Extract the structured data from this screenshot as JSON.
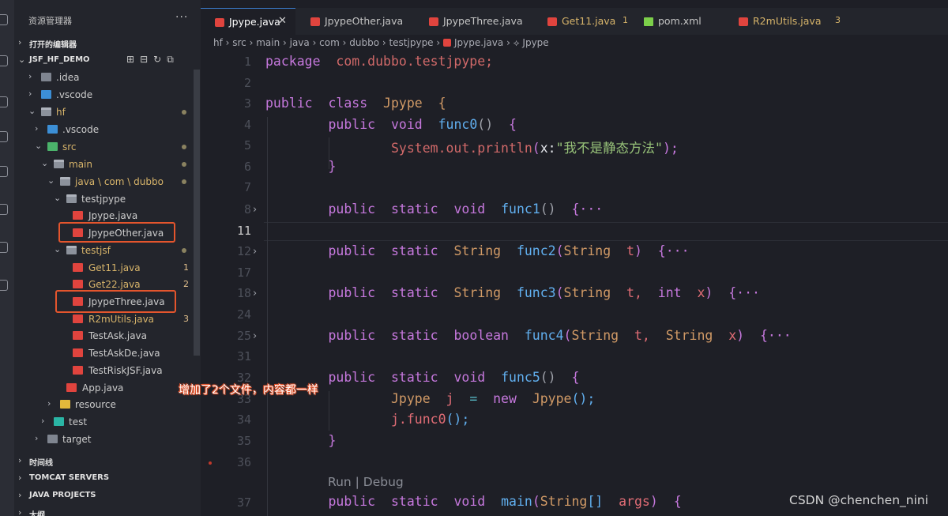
{
  "sidebar": {
    "title": "资源管理器",
    "more": "···",
    "open_editors": "打开的编辑器",
    "project": "JSF_HF_DEMO",
    "tree": [
      {
        "label": ".idea"
      },
      {
        "label": ".vscode"
      },
      {
        "label": "hf"
      },
      {
        "label": ".vscode"
      },
      {
        "label": "src"
      },
      {
        "label": "main"
      },
      {
        "label": "java \\ com \\ dubbo"
      },
      {
        "label": "testjpype"
      },
      {
        "label": "Jpype.java"
      },
      {
        "label": "JpypeOther.java"
      },
      {
        "label": "testjsf"
      },
      {
        "label": "Get11.java",
        "badge": "1"
      },
      {
        "label": "Get22.java",
        "badge": "2"
      },
      {
        "label": "JpypeThree.java"
      },
      {
        "label": "R2mUtils.java",
        "badge": "3"
      },
      {
        "label": "TestAsk.java"
      },
      {
        "label": "TestAskDe.java"
      },
      {
        "label": "TestRiskJSF.java"
      },
      {
        "label": "App.java"
      },
      {
        "label": "resource"
      },
      {
        "label": "test"
      },
      {
        "label": "target"
      }
    ],
    "sections": [
      "时间线",
      "TOMCAT SERVERS",
      "JAVA PROJECTS",
      "大纲"
    ]
  },
  "tabs": [
    {
      "label": "Jpype.java",
      "close": "✕"
    },
    {
      "label": "JpypeOther.java"
    },
    {
      "label": "JpypeThree.java"
    },
    {
      "label": "Get11.java",
      "count": "1"
    },
    {
      "label": "pom.xml"
    },
    {
      "label": "R2mUtils.java",
      "count": "3"
    }
  ],
  "breadcrumb": "hf › src › main › java › com › dubbo › testjpype ›",
  "breadcrumb_file": "Jpype.java",
  "breadcrumb_symbol": "› ⟡ Jpype",
  "line_numbers": [
    "1",
    "2",
    "3",
    "4",
    "5",
    "6",
    "7",
    "8",
    "11",
    "12",
    "17",
    "18",
    "24",
    "25",
    "31",
    "32",
    "33",
    "34",
    "35",
    "36",
    "37"
  ],
  "code": {
    "l1_kw": "package",
    "l1_pkg": "com.dubbo.testjpype",
    "l1_end": ";",
    "l3_a": "public",
    "l3_b": "class",
    "l3_c": "Jpype",
    "l3_d": "{",
    "l4_a": "public",
    "l4_b": "void",
    "l4_c": "func0",
    "l4_d": "()",
    "l4_e": "{",
    "l5_a": "System",
    "l5_b": ".",
    "l5_c": "out",
    "l5_d": ".",
    "l5_e": "println",
    "l5_f": "(",
    "l5_g": "x:",
    "l5_h": "\"我不是静态方法\"",
    "l5_i": ");",
    "l6": "}",
    "l8_a": "public",
    "l8_b": "static",
    "l8_c": "void",
    "l8_d": "func1",
    "l8_e": "()",
    "l8_f": "{···",
    "l12_a": "public",
    "l12_b": "static",
    "l12_c": "String",
    "l12_d": "func2",
    "l12_e": "(",
    "l12_f": "String",
    "l12_g": "t",
    "l12_h": ")",
    "l12_i": "{···",
    "l18_a": "public",
    "l18_b": "static",
    "l18_c": "String",
    "l18_d": "func3",
    "l18_e": "(",
    "l18_f": "String",
    "l18_g": "t,",
    "l18_h": "int",
    "l18_i": "x",
    "l18_j": ")",
    "l18_k": "{···",
    "l25_a": "public",
    "l25_b": "static",
    "l25_c": "boolean",
    "l25_d": "func4",
    "l25_e": "(",
    "l25_f": "String",
    "l25_g": "t,",
    "l25_h": "String",
    "l25_i": "x",
    "l25_j": ")",
    "l25_k": "{···",
    "l32_a": "public",
    "l32_b": "static",
    "l32_c": "void",
    "l32_d": "func5",
    "l32_e": "()",
    "l32_f": "{",
    "l33_a": "Jpype",
    "l33_b": "j",
    "l33_c": "=",
    "l33_d": "new",
    "l33_e": "Jpype",
    "l33_f": "();",
    "l34_a": "j",
    "l34_b": ".",
    "l34_c": "func0",
    "l34_d": "();",
    "l35": "}",
    "l37_a": "public",
    "l37_b": "static",
    "l37_c": "void",
    "l37_d": "main",
    "l37_e": "(",
    "l37_f": "String",
    "l37_g": "[]",
    "l37_h": "args",
    "l37_i": ")",
    "l37_j": "{"
  },
  "codelens": "Run | Debug",
  "annotation": "增加了2个文件，内容都一样",
  "watermark": "CSDN @chenchen_nini",
  "colors": {
    "highlight_box": "#e4552d",
    "accent": "#3c7fd1",
    "java_icon": "#e0443e"
  }
}
